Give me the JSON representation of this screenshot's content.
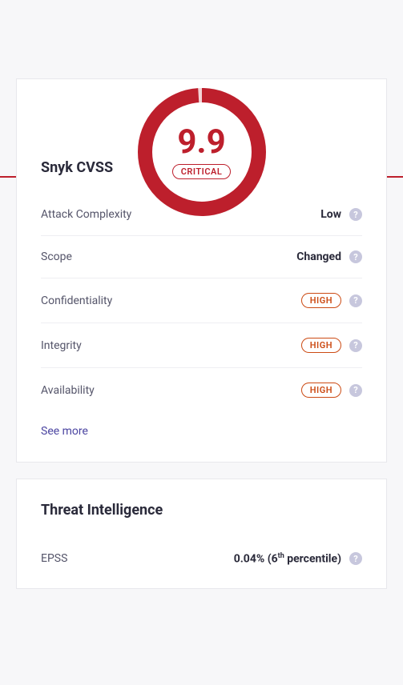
{
  "score": {
    "value": "9.9",
    "severity": "CRITICAL",
    "fillPercent": 99
  },
  "cvss": {
    "title": "Snyk CVSS",
    "metrics": [
      {
        "label": "Attack Complexity",
        "value": "Low",
        "pill": false
      },
      {
        "label": "Scope",
        "value": "Changed",
        "pill": false
      },
      {
        "label": "Confidentiality",
        "value": "HIGH",
        "pill": true
      },
      {
        "label": "Integrity",
        "value": "HIGH",
        "pill": true
      },
      {
        "label": "Availability",
        "value": "HIGH",
        "pill": true
      }
    ],
    "seeMore": "See more"
  },
  "threat": {
    "title": "Threat Intelligence",
    "epssLabel": "EPSS",
    "epssPercent": "0.04%",
    "epssPercentileRank": "6",
    "epssPercentileSuffix": "th",
    "epssPercentileWord": "percentile"
  }
}
